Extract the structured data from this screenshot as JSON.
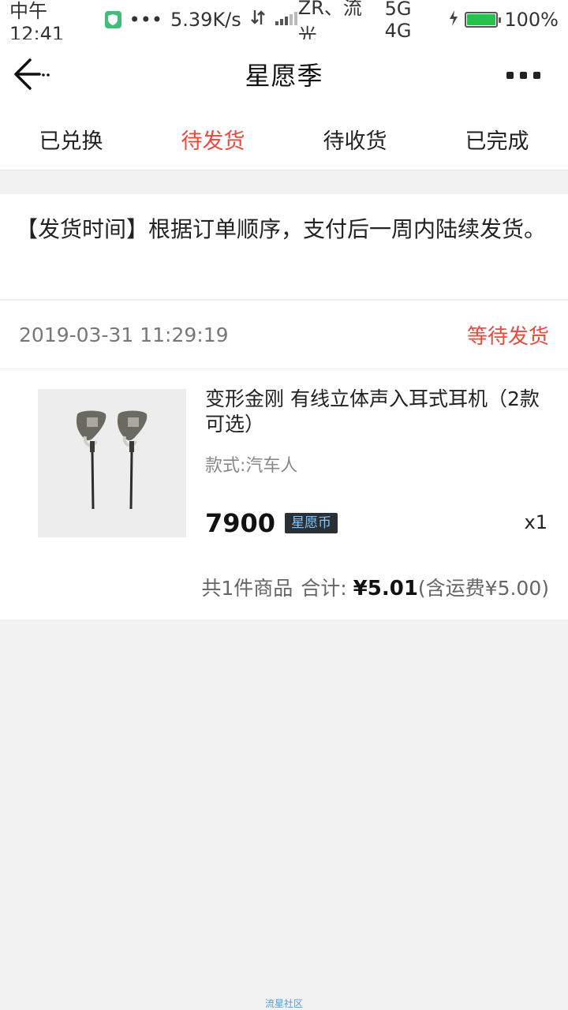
{
  "status_bar": {
    "time": "中午12:41",
    "dots": "•••",
    "speed": "5.39K/s",
    "carrier": "ZR、流光",
    "network": "5G 4G",
    "battery_pct": "100%",
    "battery_level": 1.0
  },
  "header": {
    "title": "星愿季"
  },
  "tabs": [
    {
      "label": "已兑换",
      "active": false
    },
    {
      "label": "待发货",
      "active": true
    },
    {
      "label": "待收货",
      "active": false
    },
    {
      "label": "已完成",
      "active": false
    }
  ],
  "notice": {
    "text": "【发货时间】根据订单顺序，支付后一周内陆续发货。"
  },
  "order": {
    "time": "2019-03-31 11:29:19",
    "status": "等待发货",
    "product": {
      "name": "变形金刚 有线立体声入耳式耳机（2款可选）",
      "spec": "款式:汽车人",
      "price": "7900",
      "currency_badge": "星愿币",
      "qty": "x1"
    },
    "summary": {
      "count_text": "共1件商品",
      "total_label": "合计:",
      "total": "¥5.01",
      "shipping": "(含运费¥5.00)"
    }
  },
  "footer": {
    "brand": "流星社区"
  },
  "colors": {
    "accent": "#f0463c",
    "coin_badge_bg": "#2b3036",
    "coin_badge_text": "#7fc4ff",
    "battery": "#27c24c"
  }
}
